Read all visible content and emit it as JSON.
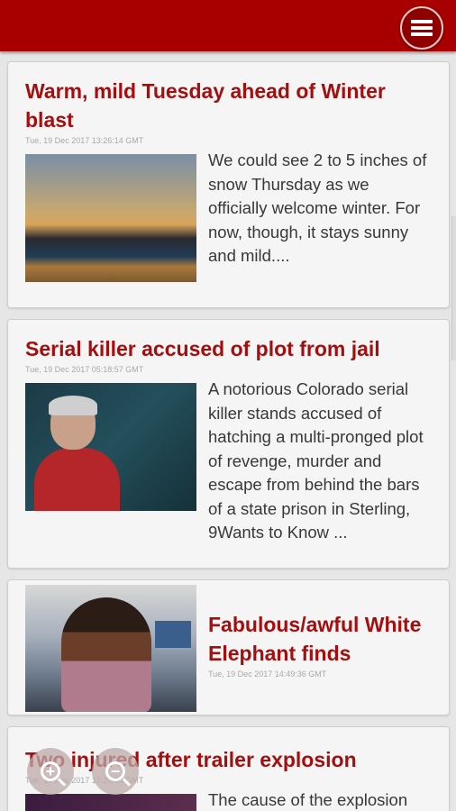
{
  "header": {
    "menu_icon": "hamburger-menu-icon",
    "bar_color": "#a80000"
  },
  "articles": [
    {
      "title": "Warm, mild Tuesday ahead of Winter blast",
      "date": "Tue, 19 Dec 2017 13:26:14 GMT",
      "summary": "We could see 2 to 5 inches of snow Thursday as we officially welcome winter. For now, though, it stays sunny and mild....",
      "image": "city-skyline-thumbnail"
    },
    {
      "title": "Serial killer accused of plot from jail",
      "date": "Tue, 19 Dec 2017 05:18:57 GMT",
      "summary": "A notorious Colorado serial killer stands accused of hatching a multi-pronged plot of revenge, murder and escape from behind the bars of a state prison in Sterling, 9Wants to Know ...",
      "image": "courtroom-thumbnail"
    },
    {
      "title": "Fabulous/awful White Elephant finds",
      "date": "Tue, 19 Dec 2017 14:49:36 GMT",
      "summary": "",
      "image": "newsroom-thumbnail"
    },
    {
      "title": "Two injured after trailer explosion",
      "date": "Tue, 19 Dec 2017 17:20:00 GMT",
      "summary": "The cause of the explosion",
      "image": "explosion-thumbnail"
    }
  ],
  "zoom": {
    "in_icon": "zoom-in-icon",
    "out_icon": "zoom-out-icon",
    "in_label": "+",
    "out_label": "−"
  },
  "accent_color": "#a50e0e"
}
